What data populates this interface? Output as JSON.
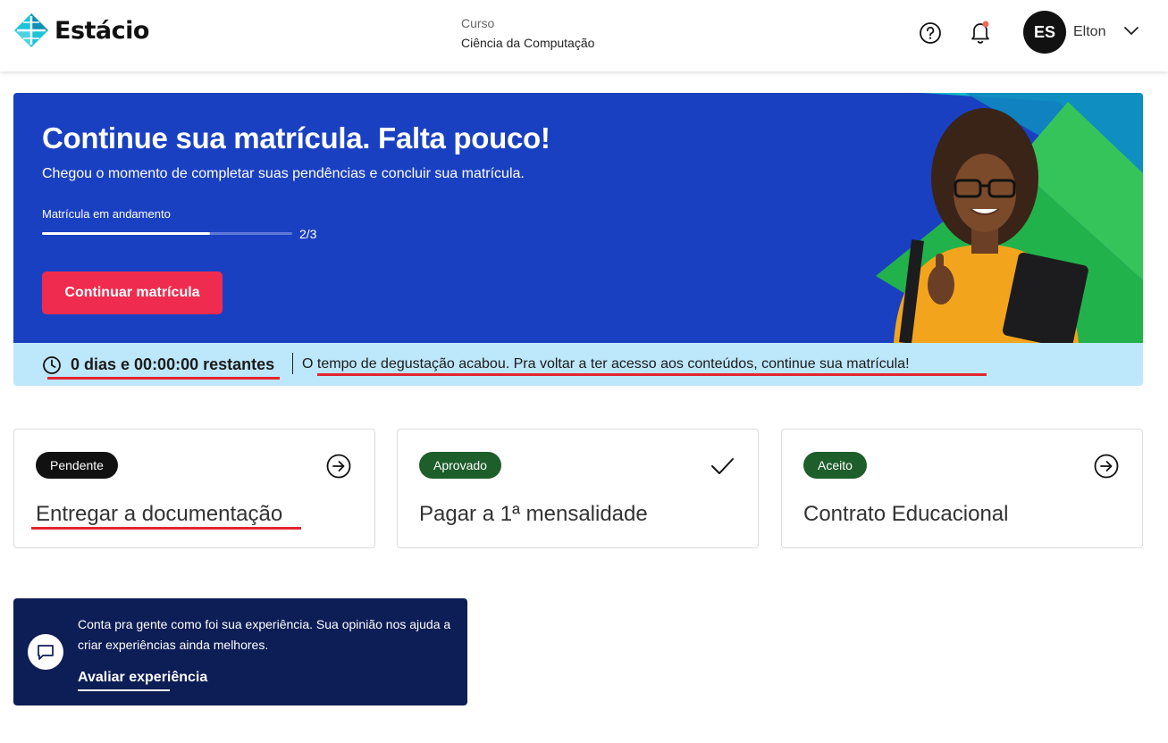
{
  "header": {
    "brand": "Estácio",
    "course_label": "Curso",
    "course_name": "Ciência da Computação",
    "help_icon": "help-circle-icon",
    "notification_icon": "bell-icon",
    "user_initials": "ES",
    "user_name": "Elton",
    "user_menu_icon": "chevron-down-icon"
  },
  "banner": {
    "title": "Continue sua matrícula. Falta pouco!",
    "subtitle": "Chegou o momento de completar suas pendências e concluir sua matrícula.",
    "progress_label": "Matrícula em andamento",
    "progress_count": "2/3",
    "progress_fraction": 0.67,
    "cta_label": "Continuar matrícula",
    "background_color": "#1a40c2",
    "cta_color": "#ef2c4f"
  },
  "timer": {
    "icon": "clock-icon",
    "remaining": "0 dias e 00:00:00 restantes",
    "message": "O tempo de degustação acabou. Pra voltar a ter acesso aos conteúdos, continue sua matrícula!",
    "background_color": "#bde7fa"
  },
  "cards": [
    {
      "status": "Pendente",
      "title": "Entregar a documentação",
      "icon": "arrow-right-circle-icon"
    },
    {
      "status": "Aprovado",
      "title": "Pagar a 1ª mensalidade",
      "icon": "check-icon"
    },
    {
      "status": "Aceito",
      "title": "Contrato Educacional",
      "icon": "arrow-right-circle-icon"
    }
  ],
  "feedback": {
    "icon": "chat-icon",
    "text": "Conta pra gente como foi sua experiência. Sua opinião nos ajuda a criar experiências ainda melhores.",
    "link_label": "Avaliar experiência",
    "background_color": "#0d1d56"
  }
}
